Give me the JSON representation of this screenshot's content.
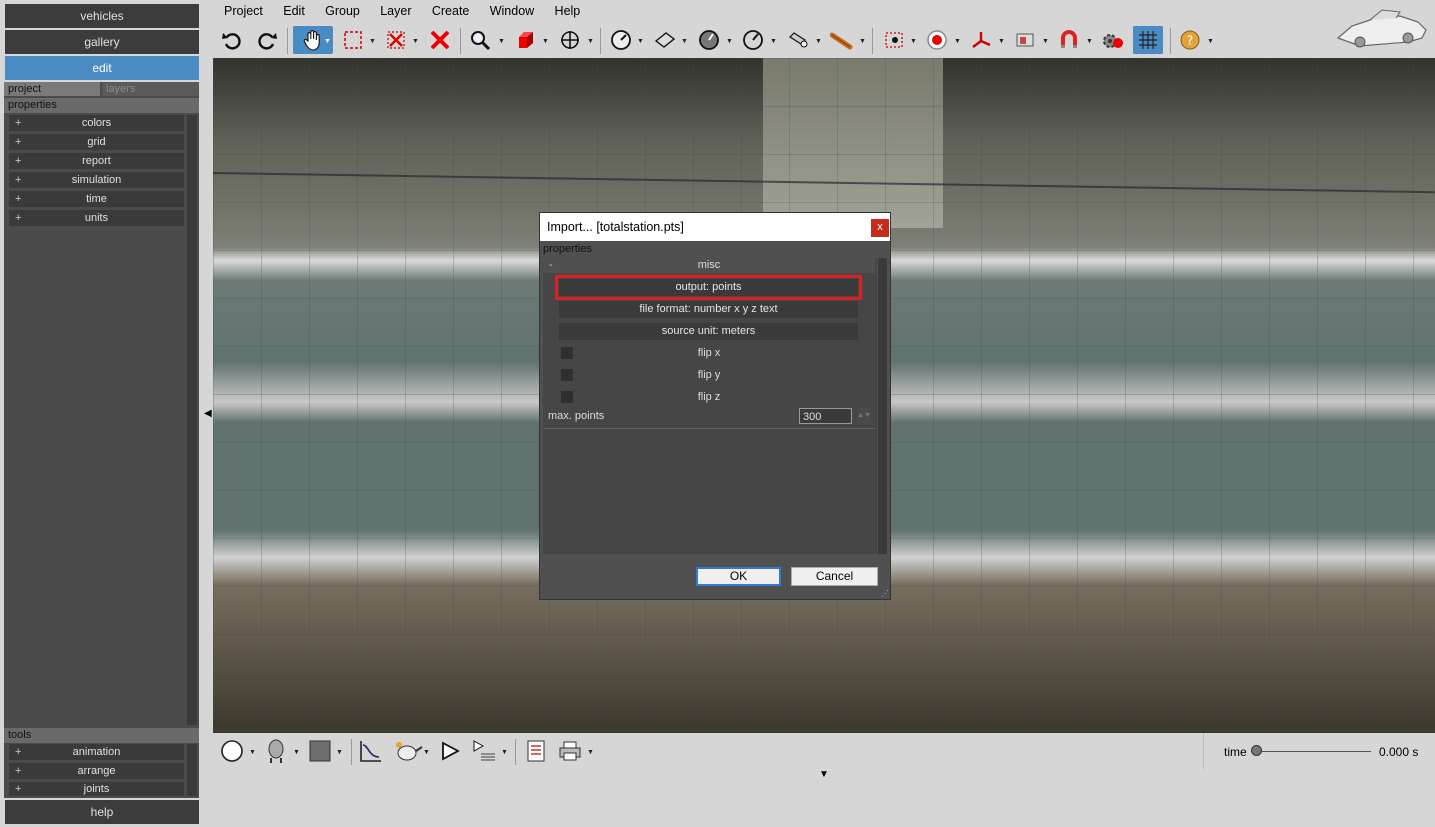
{
  "sidebar": {
    "nav": {
      "vehicles": "vehicles",
      "gallery": "gallery",
      "edit": "edit"
    },
    "tabs": {
      "project": "project",
      "layers": "layers"
    },
    "properties_header": "properties",
    "properties": [
      {
        "label": "colors"
      },
      {
        "label": "grid"
      },
      {
        "label": "report"
      },
      {
        "label": "simulation"
      },
      {
        "label": "time"
      },
      {
        "label": "units"
      }
    ],
    "expand_symbol": "+",
    "tools_header": "tools",
    "tools": [
      {
        "label": "animation"
      },
      {
        "label": "arrange"
      },
      {
        "label": "joints"
      }
    ],
    "help": "help"
  },
  "menu": [
    "Project",
    "Edit",
    "Group",
    "Layer",
    "Create",
    "Window",
    "Help"
  ],
  "toolbar": {
    "icons": [
      "undo-icon",
      "redo-icon",
      "pan-hand-icon",
      "select-box-icon",
      "delete-selection-icon",
      "delete-icon",
      "zoom-icon",
      "view-3d-box-icon",
      "move-icon",
      "measure-angle-icon",
      "plane-icon",
      "measure-dial-icon",
      "protractor-icon",
      "camera-lens-icon",
      "tape-icon",
      "target-frame-icon",
      "record-icon",
      "axes-icon",
      "photo-icon",
      "magnet-icon",
      "settings-record-icon",
      "grid-icon",
      "help-icon"
    ],
    "active": "pan-hand-icon"
  },
  "dialog": {
    "title": "Import... [totalstation.pts]",
    "close": "x",
    "properties_label": "properties",
    "section": "misc",
    "collapse_symbol": "-",
    "output": "output: points",
    "file_format": "file format: number x y z text",
    "source_unit": "source unit: meters",
    "flips": [
      {
        "label": "flip x",
        "checked": false
      },
      {
        "label": "flip y",
        "checked": false
      },
      {
        "label": "flip z",
        "checked": false
      }
    ],
    "max_points_label": "max. points",
    "max_points_value": "300",
    "ok": "OK",
    "cancel": "Cancel"
  },
  "bottombar": {
    "icons": [
      "circle-shape-icon",
      "head-icon",
      "color-swatch-icon",
      "graph-icon",
      "teapot-icon",
      "play-icon",
      "playlist-icon",
      "report-icon",
      "printer-icon"
    ],
    "time_label": "time",
    "time_value": "0.000 s",
    "time_position": 0.0
  },
  "colors": {
    "accent": "#4a8bc4",
    "highlight": "#e02020",
    "panel": "#4b4b4b"
  }
}
